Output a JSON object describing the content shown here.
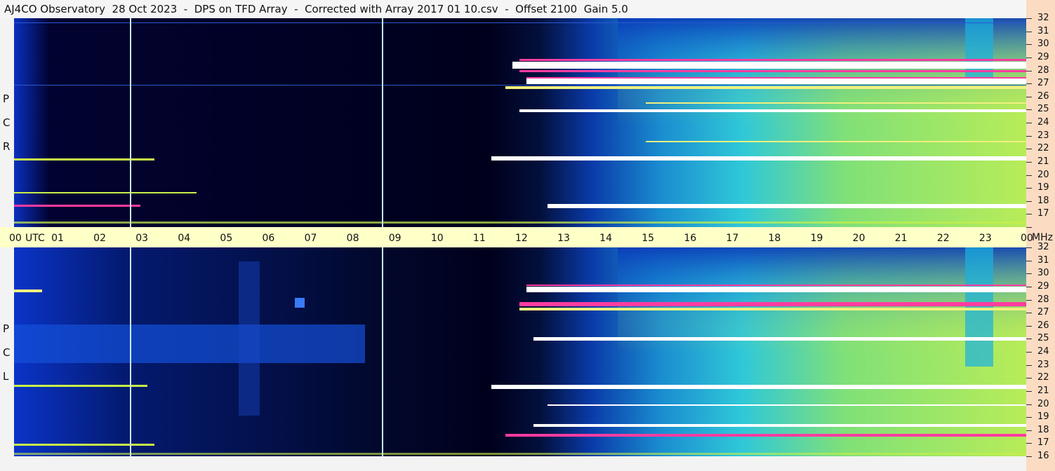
{
  "title": "AJ4CO Observatory  28 Oct 2023  -  DPS on TFD Array  -  Corrected with Array 2017 01 10.csv  -  Offset 2100  Gain 5.0",
  "chart_data": {
    "type": "heatmap",
    "title": "AJ4CO Observatory  28 Oct 2023  -  DPS on TFD Array  -  Corrected with Array 2017 01 10.csv  -  Offset 2100  Gain 5.0",
    "x_axis": {
      "label": "UTC",
      "tick_labels": [
        "00",
        "01",
        "02",
        "03",
        "04",
        "05",
        "06",
        "07",
        "08",
        "09",
        "10",
        "11",
        "12",
        "13",
        "14",
        "15",
        "16",
        "17",
        "18",
        "19",
        "20",
        "21",
        "22",
        "23",
        "00"
      ],
      "range_hours": [
        0,
        24
      ]
    },
    "y_axis": {
      "unit": "MHz",
      "tick_labels": [
        "16",
        "17",
        "18",
        "19",
        "20",
        "21",
        "22",
        "23",
        "24",
        "25",
        "26",
        "27",
        "28",
        "29",
        "30",
        "31",
        "32"
      ],
      "range_mhz": [
        16,
        32
      ]
    },
    "panels": [
      {
        "label_letters": [
          "R",
          "C",
          "P"
        ]
      },
      {
        "label_letters": [
          "L",
          "C",
          "P"
        ]
      }
    ],
    "colors": {
      "background": "#00001c",
      "low": "#0a2a9a",
      "mid": "#20b8e0",
      "high": "#c8f048",
      "peak": "#ff3ca0",
      "saturated": "#ffffff",
      "marker_line": "#c8e8ff"
    },
    "marker_lines_utc_hours": [
      2.73,
      8.72
    ]
  }
}
